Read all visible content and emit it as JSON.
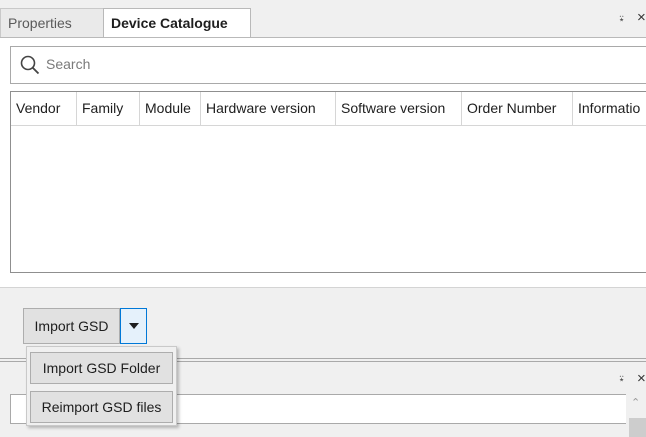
{
  "tabs": [
    {
      "label": "Properties",
      "active": false
    },
    {
      "label": "Device Catalogue",
      "active": true
    }
  ],
  "tab_controls": {
    "pin": "⍣",
    "close": "×"
  },
  "search": {
    "placeholder": "Search"
  },
  "table": {
    "columns": [
      "Vendor",
      "Family",
      "Module",
      "Hardware version",
      "Software version",
      "Order Number",
      "Informatio"
    ],
    "rows": []
  },
  "actions": {
    "import_label": "Import GSD",
    "menu": [
      "Import GSD Folder",
      "Reimport GSD files"
    ]
  },
  "lower_panel": {
    "pin": "⍣",
    "close": "×"
  },
  "colors": {
    "accent": "#0078d7",
    "dropdown_bg": "#e5f1fb"
  }
}
